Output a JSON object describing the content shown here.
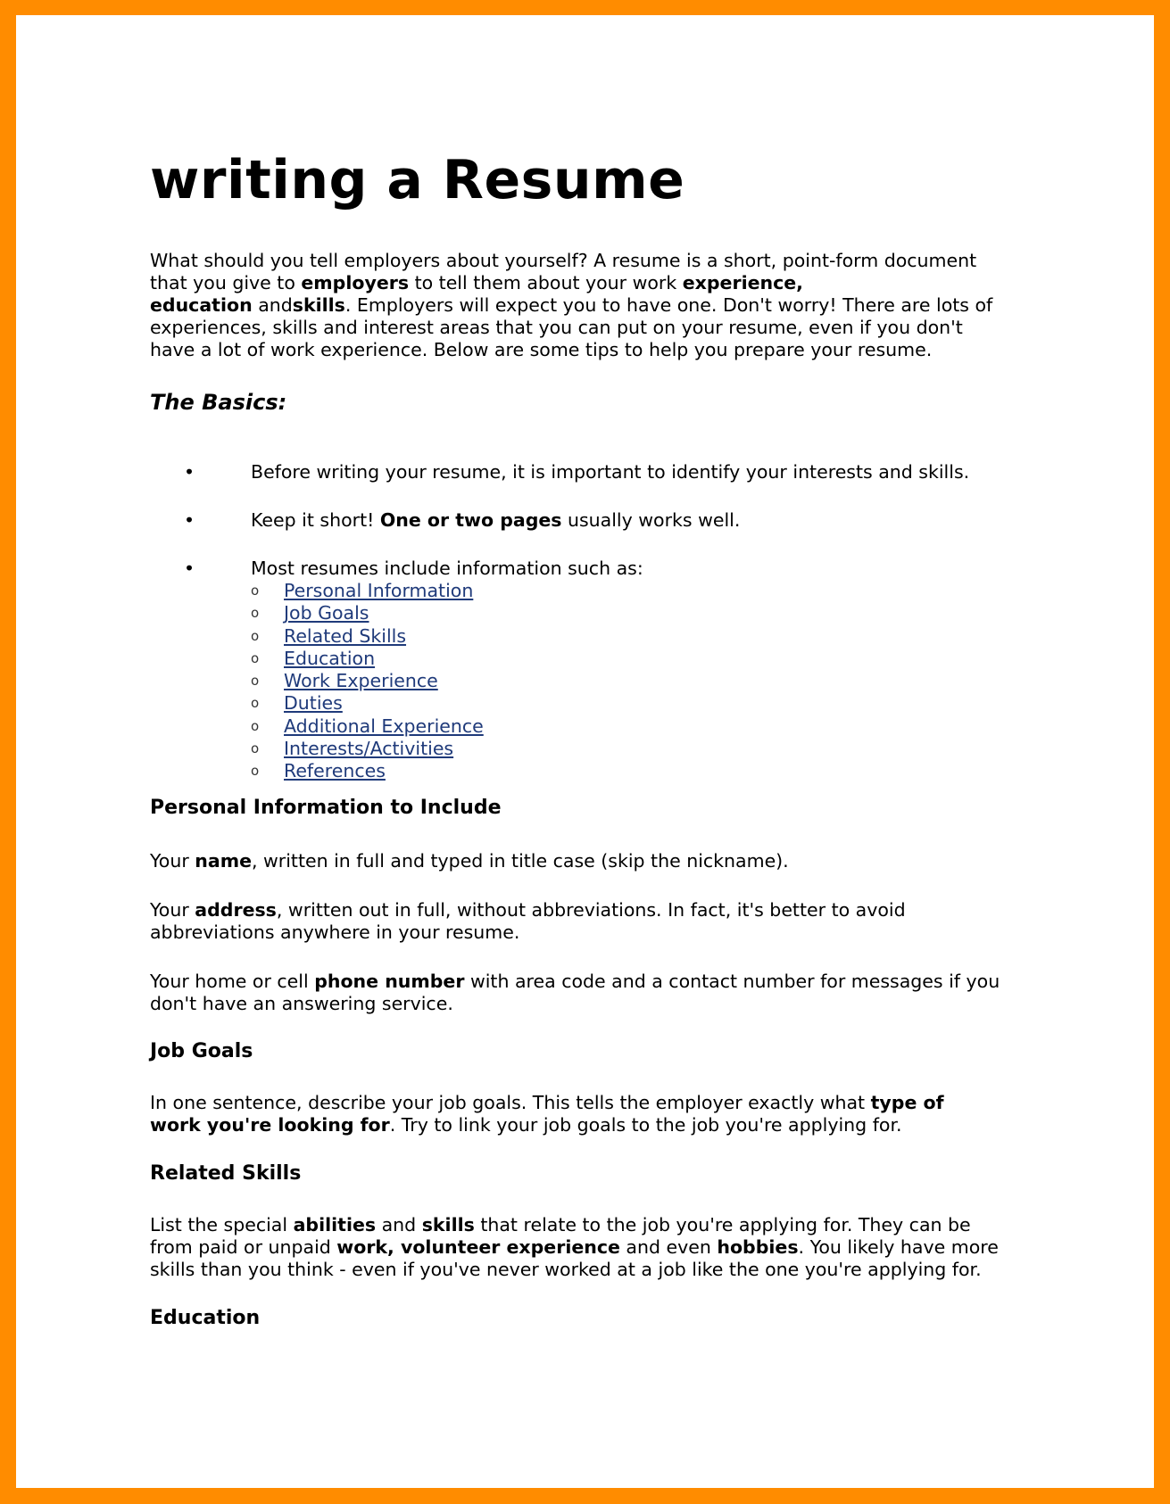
{
  "colors": {
    "frame": "#ff8c00",
    "page": "#ffffff",
    "link": "#1f3a7a"
  },
  "title": "writing a Resume",
  "intro": {
    "l1": "What should you tell employers about yourself? A resume is a short, point-form document",
    "l2a": "that you give to ",
    "l2b": "employers",
    "l2c": " to tell them about your work ",
    "l2d": "experience,",
    "l3a": "education",
    "l3b": " and",
    "l3c": "skills",
    "l3d": ". Employers will expect you to have one. Don't worry! There are lots of",
    "l4": "experiences, skills and interest areas that you can put on your resume, even if you don't",
    "l5": "have a lot of work experience. Below are some tips to help you prepare your resume."
  },
  "basics": {
    "heading": "The Basics:",
    "b1": "Before writing your resume, it is important to identify your interests and skills.",
    "b2a": "Keep it short! ",
    "b2b": "One or two pages",
    "b2c": " usually works well.",
    "b3": "Most resumes include information such as:",
    "bullet_glyph": "•",
    "sub_glyph": "o",
    "links": [
      "Personal Information",
      "Job Goals",
      "Related Skills",
      "Education",
      "Work Experience",
      "Duties",
      "Additional Experience",
      "Interests/Activities",
      "References"
    ]
  },
  "personal": {
    "heading": "Personal Information to Include",
    "p1a": "Your ",
    "p1b": "name",
    "p1c": ", written in full and typed in title case (skip the nickname).",
    "p2a": "Your ",
    "p2b": "address",
    "p2c": ", written out in full, without abbreviations. In fact, it's better to avoid",
    "p2d": "abbreviations anywhere in your resume.",
    "p3a": "Your home or cell ",
    "p3b": "phone number",
    "p3c": " with area code and a contact number for messages if you",
    "p3d": "don't have an answering service."
  },
  "job_goals": {
    "heading": "Job Goals",
    "l1a": "In one sentence, describe your job goals. This tells the employer exactly what ",
    "l1b": "type of",
    "l2a": "work you're looking for",
    "l2b": ". Try to link your job goals to the job you're applying for."
  },
  "skills": {
    "heading": "Related Skills",
    "l1a": "List the special ",
    "l1b": "abilities",
    "l1c": " and ",
    "l1d": "skills",
    "l1e": " that relate to the job you're applying for. They can be",
    "l2a": "from paid or unpaid ",
    "l2b": "work, volunteer experience",
    "l2c": " and even ",
    "l2d": "hobbies",
    "l2e": ". You likely have more",
    "l3": "skills than you think - even if you've never worked at a job like the one you're applying for."
  },
  "education": {
    "heading": "Education"
  }
}
